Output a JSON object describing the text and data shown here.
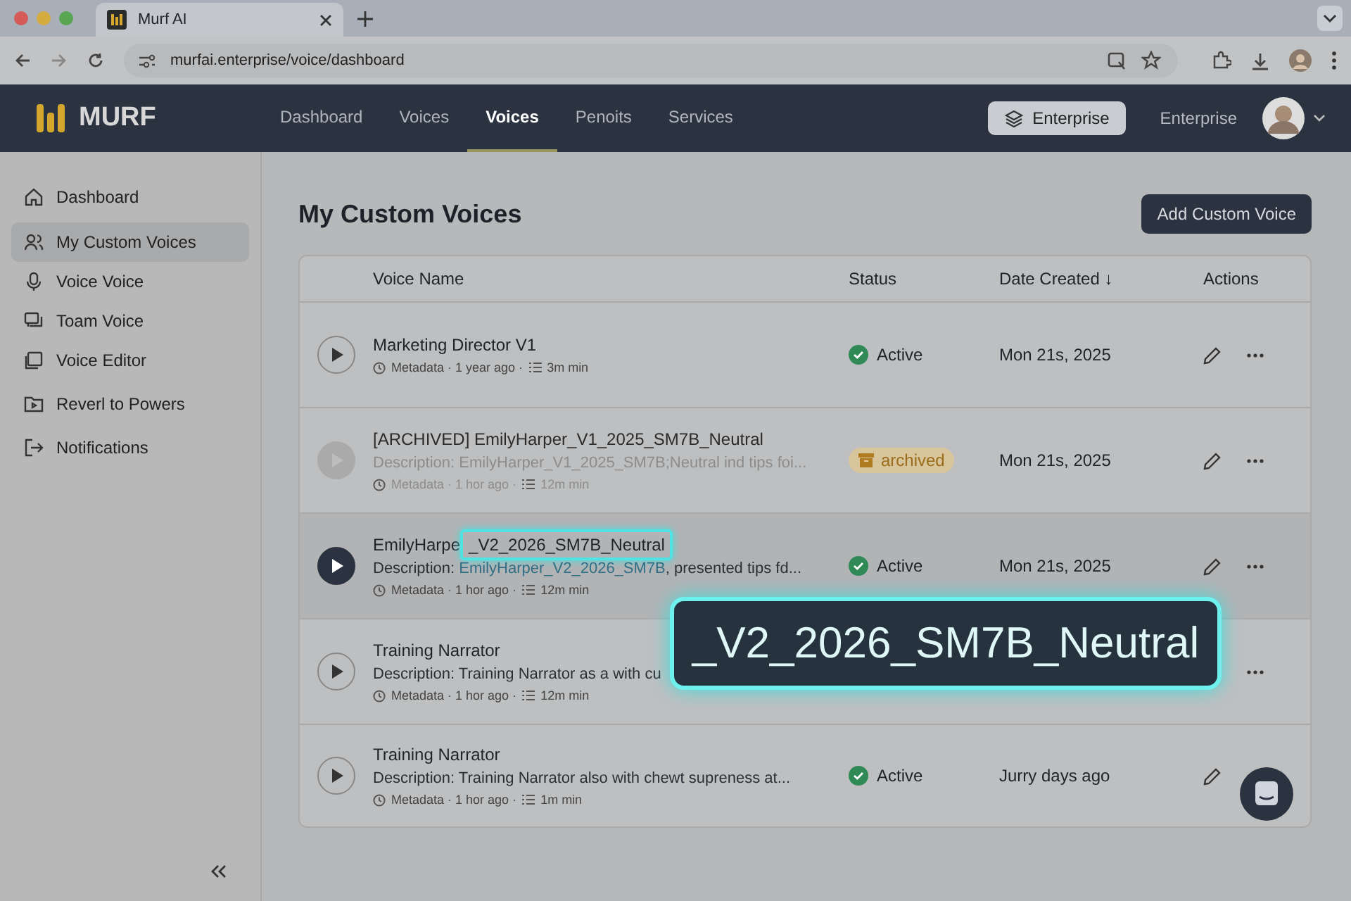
{
  "browser": {
    "tab_title": "Murf AI",
    "url": "murfai.enterprise/voice/dashboard"
  },
  "nav": {
    "brand": "MURF",
    "items": [
      {
        "label": "Dashboard",
        "selected": false
      },
      {
        "label": "Voices",
        "selected": false
      },
      {
        "label": "Voices",
        "selected": true
      },
      {
        "label": "Penoits",
        "selected": false
      },
      {
        "label": "Services",
        "selected": false
      }
    ],
    "plan_button": "Enterprise",
    "plan_label": "Enterprise"
  },
  "sidebar": {
    "items": [
      {
        "label": "Dashboard",
        "selected": false
      },
      {
        "label": "My Custom Voices",
        "selected": true
      },
      {
        "label": "Voice Voice",
        "selected": false
      },
      {
        "label": "Toam Voice",
        "selected": false
      },
      {
        "label": "Voice Editor",
        "selected": false
      },
      {
        "label": "Reverl to Powers",
        "selected": false
      },
      {
        "label": "Notifications",
        "selected": false
      }
    ]
  },
  "page": {
    "title": "My Custom Voices",
    "add_button": "Add Custom Voice"
  },
  "table": {
    "columns": [
      "Voice Name",
      "Status",
      "Date Created ↓",
      "Actions"
    ],
    "rows": [
      {
        "name": "Marketing Director V1",
        "description": [],
        "meta": "Metadata · 1 year ago ·",
        "duration": "3m min",
        "status": {
          "kind": "active",
          "label": "Active"
        },
        "date": "Mon 21s, 2025",
        "archived": false,
        "selected": false
      },
      {
        "name": "[ARCHIVED] EmilyHarper_V1_2025_SM7B_Neutral",
        "description": [
          {
            "text": "Description: EmilyHarper_V1_2025_SM7B;Neutral ind tips foi...",
            "highlight": false
          }
        ],
        "meta": "Metadata · 1 hor ago ·",
        "duration": "12m min",
        "status": {
          "kind": "archived",
          "label": "archived"
        },
        "date": "Mon 21s, 2025",
        "archived": true,
        "selected": false
      },
      {
        "name": "EmilyHarpe",
        "name_highlight": "_V2_2026_SM7B_Neutral",
        "description": [
          {
            "text": "Description: ",
            "highlight": false
          },
          {
            "text": "EmilyHarper_V2_2026_SM7B",
            "highlight": true
          },
          {
            "text": ", presented tips fd...",
            "highlight": false
          }
        ],
        "meta": "Metadata · 1 hor ago ·",
        "duration": "12m min",
        "status": {
          "kind": "active",
          "label": "Active"
        },
        "date": "Mon 21s, 2025",
        "archived": false,
        "selected": true
      },
      {
        "name": "Training Narrator",
        "description": [
          {
            "text": "Description: Training Narrator as a with cu",
            "highlight": false
          }
        ],
        "meta": "Metadata · 1 hor ago ·",
        "duration": "12m min",
        "archived": false,
        "selected": false
      },
      {
        "name": "Training Narrator",
        "description": [
          {
            "text": "Description: Training Narrator also with chewt supreness at...",
            "highlight": false
          }
        ],
        "meta": "Metadata · 1 hor ago ·",
        "duration": "1m min",
        "status": {
          "kind": "active",
          "label": "Active"
        },
        "date": "Jurry days ago",
        "archived": false,
        "selected": false
      }
    ]
  },
  "callout": {
    "text": "_V2_2026_SM7B_Neutral"
  }
}
